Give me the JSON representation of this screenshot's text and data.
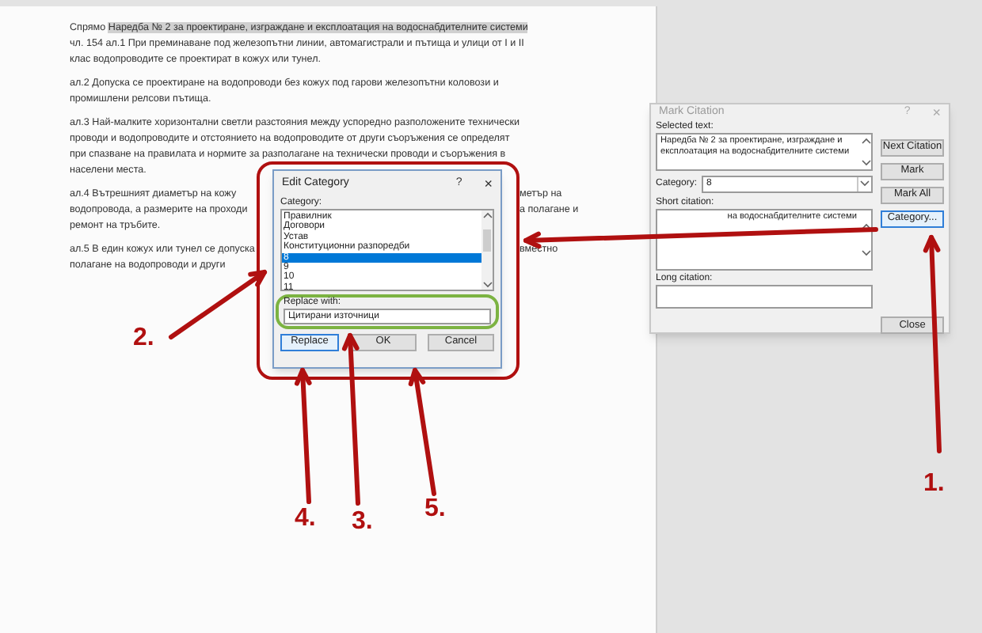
{
  "document": {
    "paragraphs": [
      {
        "lines": [
          {
            "text": "Спрямо",
            "highlight": "Наредба № 2 за проектиране, изграждане и експлоатация на водоснабдителните системи"
          },
          {
            "text": "чл. 154 ал.1 При преминаване под железопътни линии, автомагистрали и пътища и улици от I и II"
          },
          {
            "text": "клас водопроводите се проектират в кожух или тунел."
          }
        ]
      },
      {
        "lines": [
          {
            "text": "ал.2 Допуска се проектиране на водопроводи без кожух под гарови железопътни коловози и"
          },
          {
            "text": "промишлени релсови пътища."
          }
        ]
      },
      {
        "lines": [
          {
            "text": "ал.3 Най-малките хоризонтални светли разстояния между успоредно разположените технически"
          },
          {
            "text": "проводи и водопроводите и отстоянието на водопроводите от други съоръжения се определят"
          },
          {
            "text": "при спазване на правилата и нормите за разполагане на технически проводи и съоръжения в"
          },
          {
            "text": "населени места."
          }
        ]
      },
      {
        "lines": [
          {
            "left": "ал.4 Вътрешният диаметър на кожу",
            "right": "метър на"
          },
          {
            "left": "водопровода, а размерите на проходи",
            "right": "а полагане и"
          },
          {
            "text": "ремонт на тръбите."
          }
        ]
      },
      {
        "lines": [
          {
            "left": "ал.5 В един кожух или тунел се допуска",
            "right": "вместно"
          },
          {
            "left": "полагане на водопроводи и други"
          }
        ]
      }
    ]
  },
  "edit_category": {
    "title": "Edit Category",
    "active": true,
    "help": "?",
    "close": "×",
    "category_label": "Category:",
    "items": [
      {
        "label": "Правилник",
        "selected": false
      },
      {
        "label": "Договори",
        "selected": false
      },
      {
        "label": "Устав",
        "selected": false
      },
      {
        "label": "Конституционни разпоредби",
        "selected": false
      },
      {
        "label": "8",
        "selected": true
      },
      {
        "label": "9",
        "selected": false
      },
      {
        "label": "10",
        "selected": false
      },
      {
        "label": "11",
        "selected": false
      }
    ],
    "replace_label": "Replace with:",
    "replace_value": "Цитирани източници",
    "buttons": [
      {
        "label": "Replace",
        "focused": true
      },
      {
        "label": "OK",
        "focused": false
      },
      {
        "label": "Cancel",
        "focused": false
      }
    ]
  },
  "mark_citation": {
    "title": "Mark Citation",
    "active": false,
    "help": "?",
    "close": "×",
    "selected_label": "Selected text:",
    "selected_text": "Наредба № 2 за проектиране, изграждане и експлоатация на водоснабдителните системи",
    "category_label": "Category:",
    "category_value": "8",
    "short_label": "Short citation:",
    "short_value": "на водоснабдителните системи",
    "long_label": "Long citation:",
    "buttons": [
      {
        "label": "Next Citation",
        "focused": false
      },
      {
        "label": "Mark",
        "focused": false
      },
      {
        "label": "Mark All",
        "focused": false
      },
      {
        "label": "Category...",
        "focused": true
      }
    ],
    "close_button": "Close"
  },
  "annotations": [
    "2.",
    "4.",
    "3.",
    "5.",
    "1."
  ]
}
